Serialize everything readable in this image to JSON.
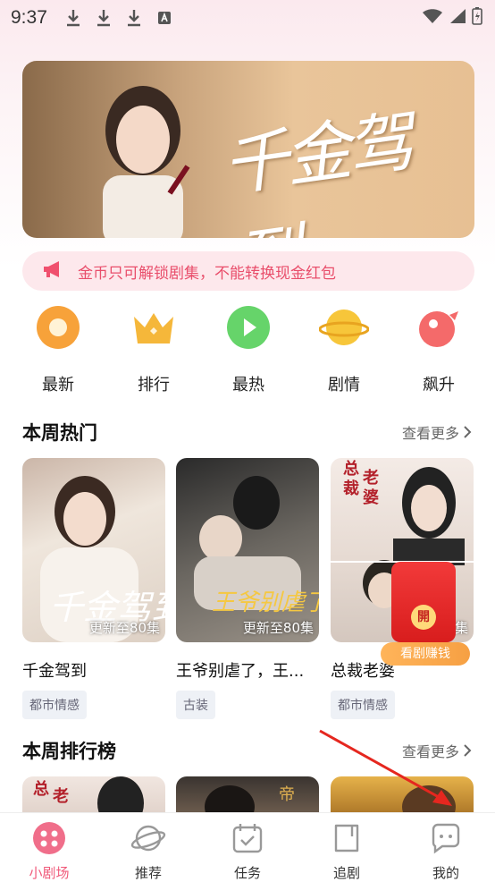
{
  "status_bar": {
    "time": "9:37"
  },
  "banner": {
    "title": "千金驾到"
  },
  "notice": {
    "text": "金币只可解锁剧集，不能转换现金红包"
  },
  "categories": [
    {
      "label": "最新",
      "icon": "new-icon",
      "color": "#f7a23a"
    },
    {
      "label": "排行",
      "icon": "crown-icon",
      "color": "#f5b73a"
    },
    {
      "label": "最热",
      "icon": "play-icon",
      "color": "#66d46a"
    },
    {
      "label": "剧情",
      "icon": "planet-icon",
      "color": "#f7c63a"
    },
    {
      "label": "飙升",
      "icon": "rocket-icon",
      "color": "#f46a6a"
    }
  ],
  "weekly_hot": {
    "title": "本周热门",
    "more": "查看更多",
    "items": [
      {
        "name": "千金驾到",
        "episodes": "更新至80集",
        "tag": "都市情感"
      },
      {
        "name": "王爷别虐了，王...",
        "episodes": "更新至80集",
        "tag": "古装"
      },
      {
        "name": "总裁老婆",
        "episodes": "集",
        "tag": "都市情感"
      }
    ]
  },
  "red_packet": {
    "label": "看剧赚钱",
    "coin": "開"
  },
  "weekly_rank": {
    "title": "本周排行榜",
    "more": "查看更多"
  },
  "tabbar": [
    {
      "label": "小剧场",
      "icon": "theater-icon",
      "active": true
    },
    {
      "label": "推荐",
      "icon": "planet-outline-icon",
      "active": false
    },
    {
      "label": "任务",
      "icon": "calendar-icon",
      "active": false
    },
    {
      "label": "追剧",
      "icon": "bookmark-icon",
      "active": false
    },
    {
      "label": "我的",
      "icon": "profile-icon",
      "active": false
    }
  ]
}
